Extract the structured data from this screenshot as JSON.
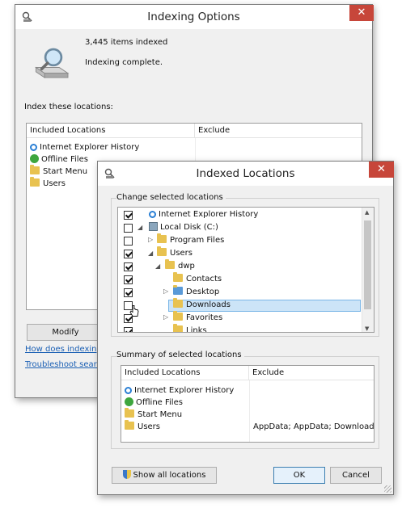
{
  "back_window": {
    "title": "Indexing Options",
    "close_label": "✕",
    "items_indexed": "3,445 items indexed",
    "status": "Indexing complete.",
    "index_label": "Index these locations:",
    "columns": {
      "included": "Included Locations",
      "exclude": "Exclude"
    },
    "locations": [
      "Internet Explorer History",
      "Offline Files",
      "Start Menu",
      "Users"
    ],
    "modify_label": "Modify",
    "link_how": "How does indexing a",
    "link_troubleshoot": "Troubleshoot search"
  },
  "front_window": {
    "title": "Indexed Locations",
    "close_label": "✕",
    "change_group": "Change selected locations",
    "tree": [
      {
        "label": "Internet Explorer History",
        "checked": true
      },
      {
        "label": "Local Disk (C:)",
        "checked": false
      },
      {
        "label": "Program Files",
        "checked": false
      },
      {
        "label": "Users",
        "checked": true
      },
      {
        "label": "dwp",
        "checked": true
      },
      {
        "label": "Contacts",
        "checked": true
      },
      {
        "label": "Desktop",
        "checked": true
      },
      {
        "label": "Downloads",
        "checked": false
      },
      {
        "label": "Favorites",
        "checked": true
      },
      {
        "label": "Links",
        "checked": true
      }
    ],
    "summary_group": "Summary of selected locations",
    "columns": {
      "included": "Included Locations",
      "exclude": "Exclude"
    },
    "summary_rows": [
      {
        "location": "Internet Explorer History",
        "exclude": ""
      },
      {
        "location": "Offline Files",
        "exclude": ""
      },
      {
        "location": "Start Menu",
        "exclude": ""
      },
      {
        "location": "Users",
        "exclude": "AppData; AppData; Downloads"
      }
    ],
    "show_all_label": "Show all locations",
    "ok_label": "OK",
    "cancel_label": "Cancel"
  },
  "colors": {
    "accent": "#1a5fb4",
    "close": "#c7463a",
    "selection": "#cce4f7"
  }
}
